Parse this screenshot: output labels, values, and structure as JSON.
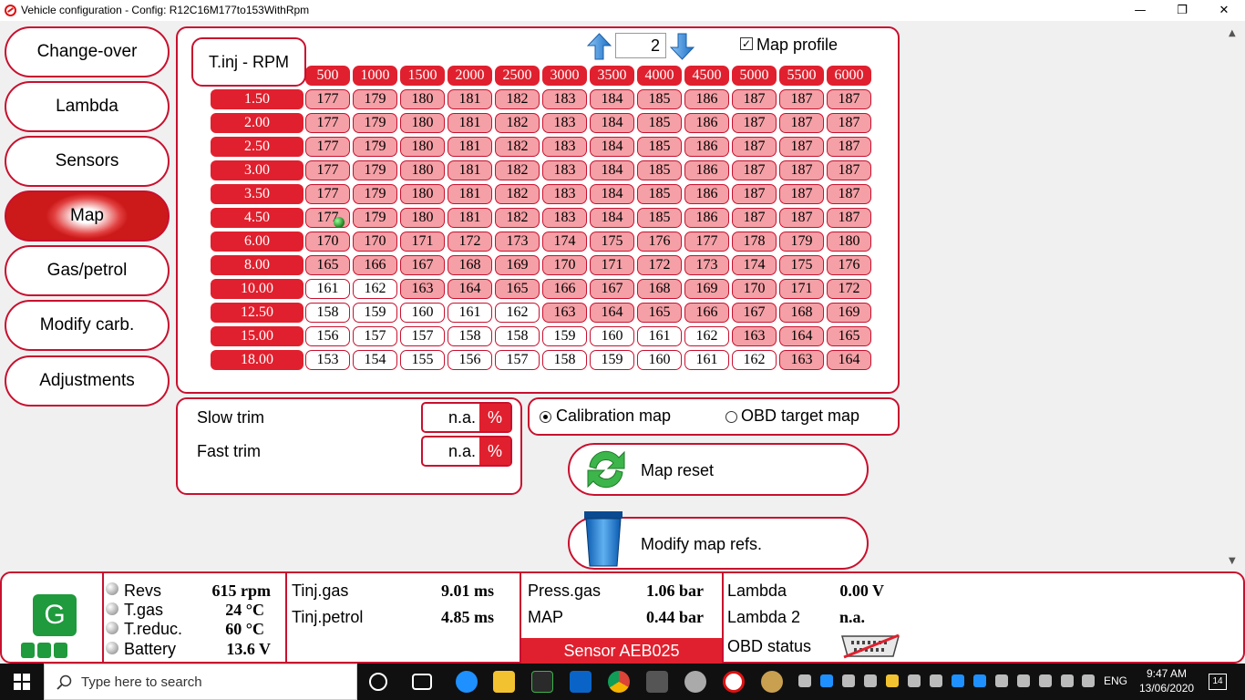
{
  "window": {
    "title": "Vehicle configuration - Config: R12C16M177to153WithRpm",
    "min_glyph": "—",
    "max_glyph": "❐",
    "close_glyph": "✕"
  },
  "sidebar": {
    "items": [
      {
        "label": "Change-over",
        "active": false
      },
      {
        "label": "Lambda",
        "active": false
      },
      {
        "label": "Sensors",
        "active": false
      },
      {
        "label": "Map",
        "active": true
      },
      {
        "label": "Gas/petrol",
        "active": false
      },
      {
        "label": "Modify carb.",
        "active": false
      },
      {
        "label": "Adjustments",
        "active": false
      }
    ]
  },
  "map": {
    "corner_label": "T.inj - RPM",
    "page_number": "2",
    "profile_checked": true,
    "profile_check_glyph": "✓",
    "profile_label": "Map profile",
    "rpm": [
      "500",
      "1000",
      "1500",
      "2000",
      "2500",
      "3000",
      "3500",
      "4000",
      "4500",
      "5000",
      "5500",
      "6000"
    ],
    "tinj": [
      "1.50",
      "2.00",
      "2.50",
      "3.00",
      "3.50",
      "4.50",
      "6.00",
      "8.00",
      "10.00",
      "12.50",
      "15.00",
      "18.00"
    ],
    "values": [
      [
        177,
        179,
        180,
        181,
        182,
        183,
        184,
        185,
        186,
        187,
        187,
        187
      ],
      [
        177,
        179,
        180,
        181,
        182,
        183,
        184,
        185,
        186,
        187,
        187,
        187
      ],
      [
        177,
        179,
        180,
        181,
        182,
        183,
        184,
        185,
        186,
        187,
        187,
        187
      ],
      [
        177,
        179,
        180,
        181,
        182,
        183,
        184,
        185,
        186,
        187,
        187,
        187
      ],
      [
        177,
        179,
        180,
        181,
        182,
        183,
        184,
        185,
        186,
        187,
        187,
        187
      ],
      [
        177,
        179,
        180,
        181,
        182,
        183,
        184,
        185,
        186,
        187,
        187,
        187
      ],
      [
        170,
        170,
        171,
        172,
        173,
        174,
        175,
        176,
        177,
        178,
        179,
        180
      ],
      [
        165,
        166,
        167,
        168,
        169,
        170,
        171,
        172,
        173,
        174,
        175,
        176
      ],
      [
        161,
        162,
        163,
        164,
        165,
        166,
        167,
        168,
        169,
        170,
        171,
        172
      ],
      [
        158,
        159,
        160,
        161,
        162,
        163,
        164,
        165,
        166,
        167,
        168,
        169
      ],
      [
        156,
        157,
        157,
        158,
        158,
        159,
        160,
        161,
        162,
        163,
        164,
        165
      ],
      [
        153,
        154,
        155,
        156,
        157,
        158,
        159,
        160,
        161,
        162,
        163,
        164
      ]
    ],
    "colors": {
      "high": "#f4a0a6",
      "low": "#ffffff",
      "header": "#e0202e"
    }
  },
  "trim": {
    "slow_label": "Slow trim",
    "slow_value": "n.a.",
    "fast_label": "Fast trim",
    "fast_value": "n.a.",
    "unit": "%"
  },
  "map_type": {
    "calibration_label": "Calibration map",
    "obd_label": "OBD target map",
    "selected": "calibration"
  },
  "actions": {
    "reset_label": "Map reset",
    "modify_refs_label": "Modify map refs."
  },
  "status": {
    "logo_letter": "G",
    "revs_label": "Revs",
    "revs_value": "615 rpm",
    "tgas_label": "T.gas",
    "tgas_value": "24 °C",
    "treduc_label": "T.reduc.",
    "treduc_value": "60 °C",
    "battery_label": "Battery",
    "battery_value": "13.6 V",
    "tinj_gas_label": "Tinj.gas",
    "tinj_gas_value": "9.01 ms",
    "tinj_petrol_label": "Tinj.petrol",
    "tinj_petrol_value": "4.85 ms",
    "press_gas_label": "Press.gas",
    "press_gas_value": "1.06 bar",
    "map_label": "MAP",
    "map_value": "0.44 bar",
    "sensor_label": "Sensor AEB025",
    "lambda_label": "Lambda",
    "lambda_value": "0.00 V",
    "lambda2_label": "Lambda 2",
    "lambda2_value": "n.a.",
    "obd_label": "OBD status"
  },
  "taskbar": {
    "search_placeholder": "Type here to search",
    "lang": "ENG",
    "time": "9:47 AM",
    "date": "13/06/2020",
    "notifications": "14"
  }
}
